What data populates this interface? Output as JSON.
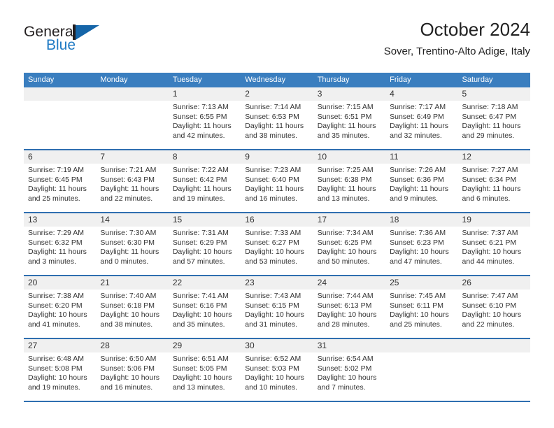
{
  "brand": {
    "word_one": "General",
    "word_two": "Blue",
    "mark": "triangle-logo"
  },
  "header": {
    "title": "October 2024",
    "subtitle": "Sover, Trentino-Alto Adige, Italy"
  },
  "colors": {
    "header_blue": "#3a7ebf",
    "rule_blue": "#2f6fb0",
    "date_strip": "#f0f0f0",
    "brand_blue": "#1f7ac4",
    "text": "#333333"
  },
  "weekdays": [
    "Sunday",
    "Monday",
    "Tuesday",
    "Wednesday",
    "Thursday",
    "Friday",
    "Saturday"
  ],
  "weeks": [
    [
      {
        "day": "",
        "lines": []
      },
      {
        "day": "",
        "lines": []
      },
      {
        "day": "1",
        "lines": [
          "Sunrise: 7:13 AM",
          "Sunset: 6:55 PM",
          "Daylight: 11 hours",
          "and 42 minutes."
        ]
      },
      {
        "day": "2",
        "lines": [
          "Sunrise: 7:14 AM",
          "Sunset: 6:53 PM",
          "Daylight: 11 hours",
          "and 38 minutes."
        ]
      },
      {
        "day": "3",
        "lines": [
          "Sunrise: 7:15 AM",
          "Sunset: 6:51 PM",
          "Daylight: 11 hours",
          "and 35 minutes."
        ]
      },
      {
        "day": "4",
        "lines": [
          "Sunrise: 7:17 AM",
          "Sunset: 6:49 PM",
          "Daylight: 11 hours",
          "and 32 minutes."
        ]
      },
      {
        "day": "5",
        "lines": [
          "Sunrise: 7:18 AM",
          "Sunset: 6:47 PM",
          "Daylight: 11 hours",
          "and 29 minutes."
        ]
      }
    ],
    [
      {
        "day": "6",
        "lines": [
          "Sunrise: 7:19 AM",
          "Sunset: 6:45 PM",
          "Daylight: 11 hours",
          "and 25 minutes."
        ]
      },
      {
        "day": "7",
        "lines": [
          "Sunrise: 7:21 AM",
          "Sunset: 6:43 PM",
          "Daylight: 11 hours",
          "and 22 minutes."
        ]
      },
      {
        "day": "8",
        "lines": [
          "Sunrise: 7:22 AM",
          "Sunset: 6:42 PM",
          "Daylight: 11 hours",
          "and 19 minutes."
        ]
      },
      {
        "day": "9",
        "lines": [
          "Sunrise: 7:23 AM",
          "Sunset: 6:40 PM",
          "Daylight: 11 hours",
          "and 16 minutes."
        ]
      },
      {
        "day": "10",
        "lines": [
          "Sunrise: 7:25 AM",
          "Sunset: 6:38 PM",
          "Daylight: 11 hours",
          "and 13 minutes."
        ]
      },
      {
        "day": "11",
        "lines": [
          "Sunrise: 7:26 AM",
          "Sunset: 6:36 PM",
          "Daylight: 11 hours",
          "and 9 minutes."
        ]
      },
      {
        "day": "12",
        "lines": [
          "Sunrise: 7:27 AM",
          "Sunset: 6:34 PM",
          "Daylight: 11 hours",
          "and 6 minutes."
        ]
      }
    ],
    [
      {
        "day": "13",
        "lines": [
          "Sunrise: 7:29 AM",
          "Sunset: 6:32 PM",
          "Daylight: 11 hours",
          "and 3 minutes."
        ]
      },
      {
        "day": "14",
        "lines": [
          "Sunrise: 7:30 AM",
          "Sunset: 6:30 PM",
          "Daylight: 11 hours",
          "and 0 minutes."
        ]
      },
      {
        "day": "15",
        "lines": [
          "Sunrise: 7:31 AM",
          "Sunset: 6:29 PM",
          "Daylight: 10 hours",
          "and 57 minutes."
        ]
      },
      {
        "day": "16",
        "lines": [
          "Sunrise: 7:33 AM",
          "Sunset: 6:27 PM",
          "Daylight: 10 hours",
          "and 53 minutes."
        ]
      },
      {
        "day": "17",
        "lines": [
          "Sunrise: 7:34 AM",
          "Sunset: 6:25 PM",
          "Daylight: 10 hours",
          "and 50 minutes."
        ]
      },
      {
        "day": "18",
        "lines": [
          "Sunrise: 7:36 AM",
          "Sunset: 6:23 PM",
          "Daylight: 10 hours",
          "and 47 minutes."
        ]
      },
      {
        "day": "19",
        "lines": [
          "Sunrise: 7:37 AM",
          "Sunset: 6:21 PM",
          "Daylight: 10 hours",
          "and 44 minutes."
        ]
      }
    ],
    [
      {
        "day": "20",
        "lines": [
          "Sunrise: 7:38 AM",
          "Sunset: 6:20 PM",
          "Daylight: 10 hours",
          "and 41 minutes."
        ]
      },
      {
        "day": "21",
        "lines": [
          "Sunrise: 7:40 AM",
          "Sunset: 6:18 PM",
          "Daylight: 10 hours",
          "and 38 minutes."
        ]
      },
      {
        "day": "22",
        "lines": [
          "Sunrise: 7:41 AM",
          "Sunset: 6:16 PM",
          "Daylight: 10 hours",
          "and 35 minutes."
        ]
      },
      {
        "day": "23",
        "lines": [
          "Sunrise: 7:43 AM",
          "Sunset: 6:15 PM",
          "Daylight: 10 hours",
          "and 31 minutes."
        ]
      },
      {
        "day": "24",
        "lines": [
          "Sunrise: 7:44 AM",
          "Sunset: 6:13 PM",
          "Daylight: 10 hours",
          "and 28 minutes."
        ]
      },
      {
        "day": "25",
        "lines": [
          "Sunrise: 7:45 AM",
          "Sunset: 6:11 PM",
          "Daylight: 10 hours",
          "and 25 minutes."
        ]
      },
      {
        "day": "26",
        "lines": [
          "Sunrise: 7:47 AM",
          "Sunset: 6:10 PM",
          "Daylight: 10 hours",
          "and 22 minutes."
        ]
      }
    ],
    [
      {
        "day": "27",
        "lines": [
          "Sunrise: 6:48 AM",
          "Sunset: 5:08 PM",
          "Daylight: 10 hours",
          "and 19 minutes."
        ]
      },
      {
        "day": "28",
        "lines": [
          "Sunrise: 6:50 AM",
          "Sunset: 5:06 PM",
          "Daylight: 10 hours",
          "and 16 minutes."
        ]
      },
      {
        "day": "29",
        "lines": [
          "Sunrise: 6:51 AM",
          "Sunset: 5:05 PM",
          "Daylight: 10 hours",
          "and 13 minutes."
        ]
      },
      {
        "day": "30",
        "lines": [
          "Sunrise: 6:52 AM",
          "Sunset: 5:03 PM",
          "Daylight: 10 hours",
          "and 10 minutes."
        ]
      },
      {
        "day": "31",
        "lines": [
          "Sunrise: 6:54 AM",
          "Sunset: 5:02 PM",
          "Daylight: 10 hours",
          "and 7 minutes."
        ]
      },
      {
        "day": "",
        "lines": []
      },
      {
        "day": "",
        "lines": []
      }
    ]
  ]
}
